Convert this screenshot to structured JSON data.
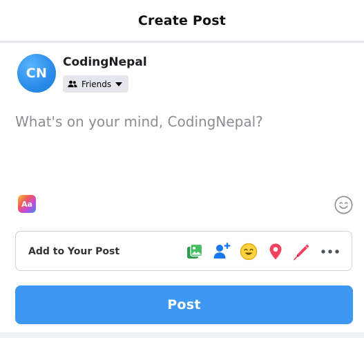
{
  "header": {
    "title": "Create Post"
  },
  "user": {
    "avatar_initials": "CN",
    "name": "CodingNepal",
    "privacy": {
      "selected": "Friends",
      "icon": "friends-icon"
    }
  },
  "composer": {
    "placeholder": "What's on your mind, CodingNepal?"
  },
  "toolbar": {
    "text_style_label": "Aa",
    "emoji_icon": "smiley-icon"
  },
  "add_to_post": {
    "label": "Add to Your Post",
    "icons": [
      "photo-video-icon",
      "tag-people-icon",
      "feeling-icon",
      "check-in-icon",
      "draw-icon",
      "more-icon"
    ]
  },
  "actions": {
    "post_label": "Post"
  },
  "colors": {
    "accent": "#3d98f4",
    "muted_text": "#8a8d91",
    "divider": "#e4e6eb"
  }
}
